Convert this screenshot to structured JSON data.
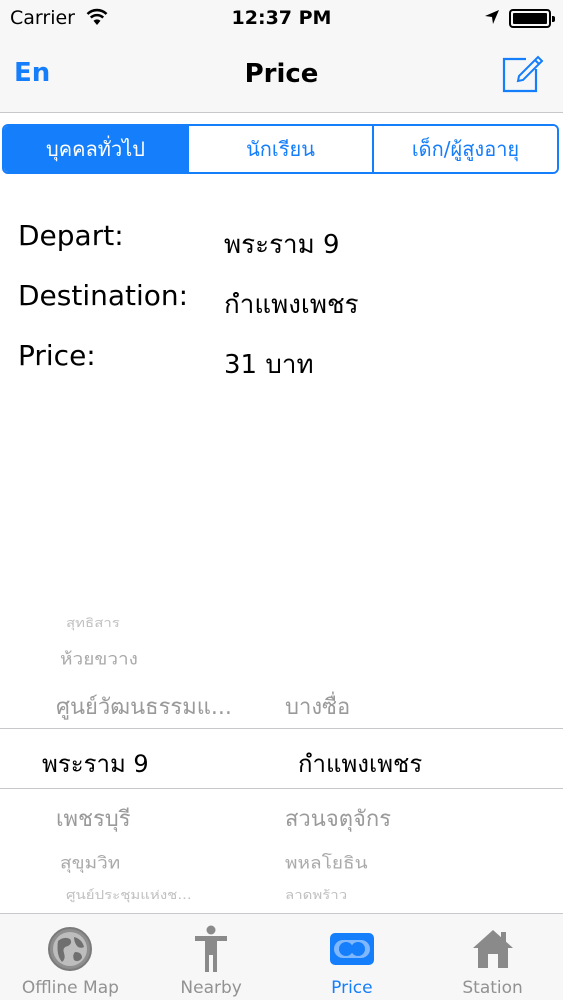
{
  "status_bar": {
    "carrier": "Carrier",
    "time": "12:37 PM"
  },
  "nav": {
    "left_button": "En",
    "title": "Price"
  },
  "segments": [
    {
      "label": "บุคคลทั่วไป",
      "active": true
    },
    {
      "label": "นักเรียน",
      "active": false
    },
    {
      "label": "เด็ก/ผู้สูงอายุ",
      "active": false
    }
  ],
  "info": {
    "depart_label": "Depart:",
    "depart_value": "พระราม 9",
    "destination_label": "Destination:",
    "destination_value": "กำแพงเพชร",
    "price_label": "Price:",
    "price_value": "31  บาท"
  },
  "picker": {
    "left_above": [
      "สุทธิสาร",
      "ห้วยขวาง",
      "ศูนย์วัฒนธรรมแ..."
    ],
    "left_selected": "พระราม 9",
    "left_below": [
      "เพชรบุรี",
      "สุขุมวิท",
      "ศูนย์ประชุมแห่งช..."
    ],
    "right_above": [
      "บางซื่อ"
    ],
    "right_selected": "กำแพงเพชร",
    "right_below": [
      "สวนจตุจักร",
      "พหลโยธิน",
      "ลาดพร้าว"
    ]
  },
  "tabs": [
    {
      "label": "Offline Map",
      "icon": "globe-icon",
      "active": false
    },
    {
      "label": "Nearby",
      "icon": "person-icon",
      "active": false
    },
    {
      "label": "Price",
      "icon": "ticket-icon",
      "active": true
    },
    {
      "label": "Station",
      "icon": "home-icon",
      "active": false
    }
  ],
  "colors": {
    "accent": "#157efb",
    "inactive": "#929292",
    "bar_bg": "#f7f7f8"
  }
}
